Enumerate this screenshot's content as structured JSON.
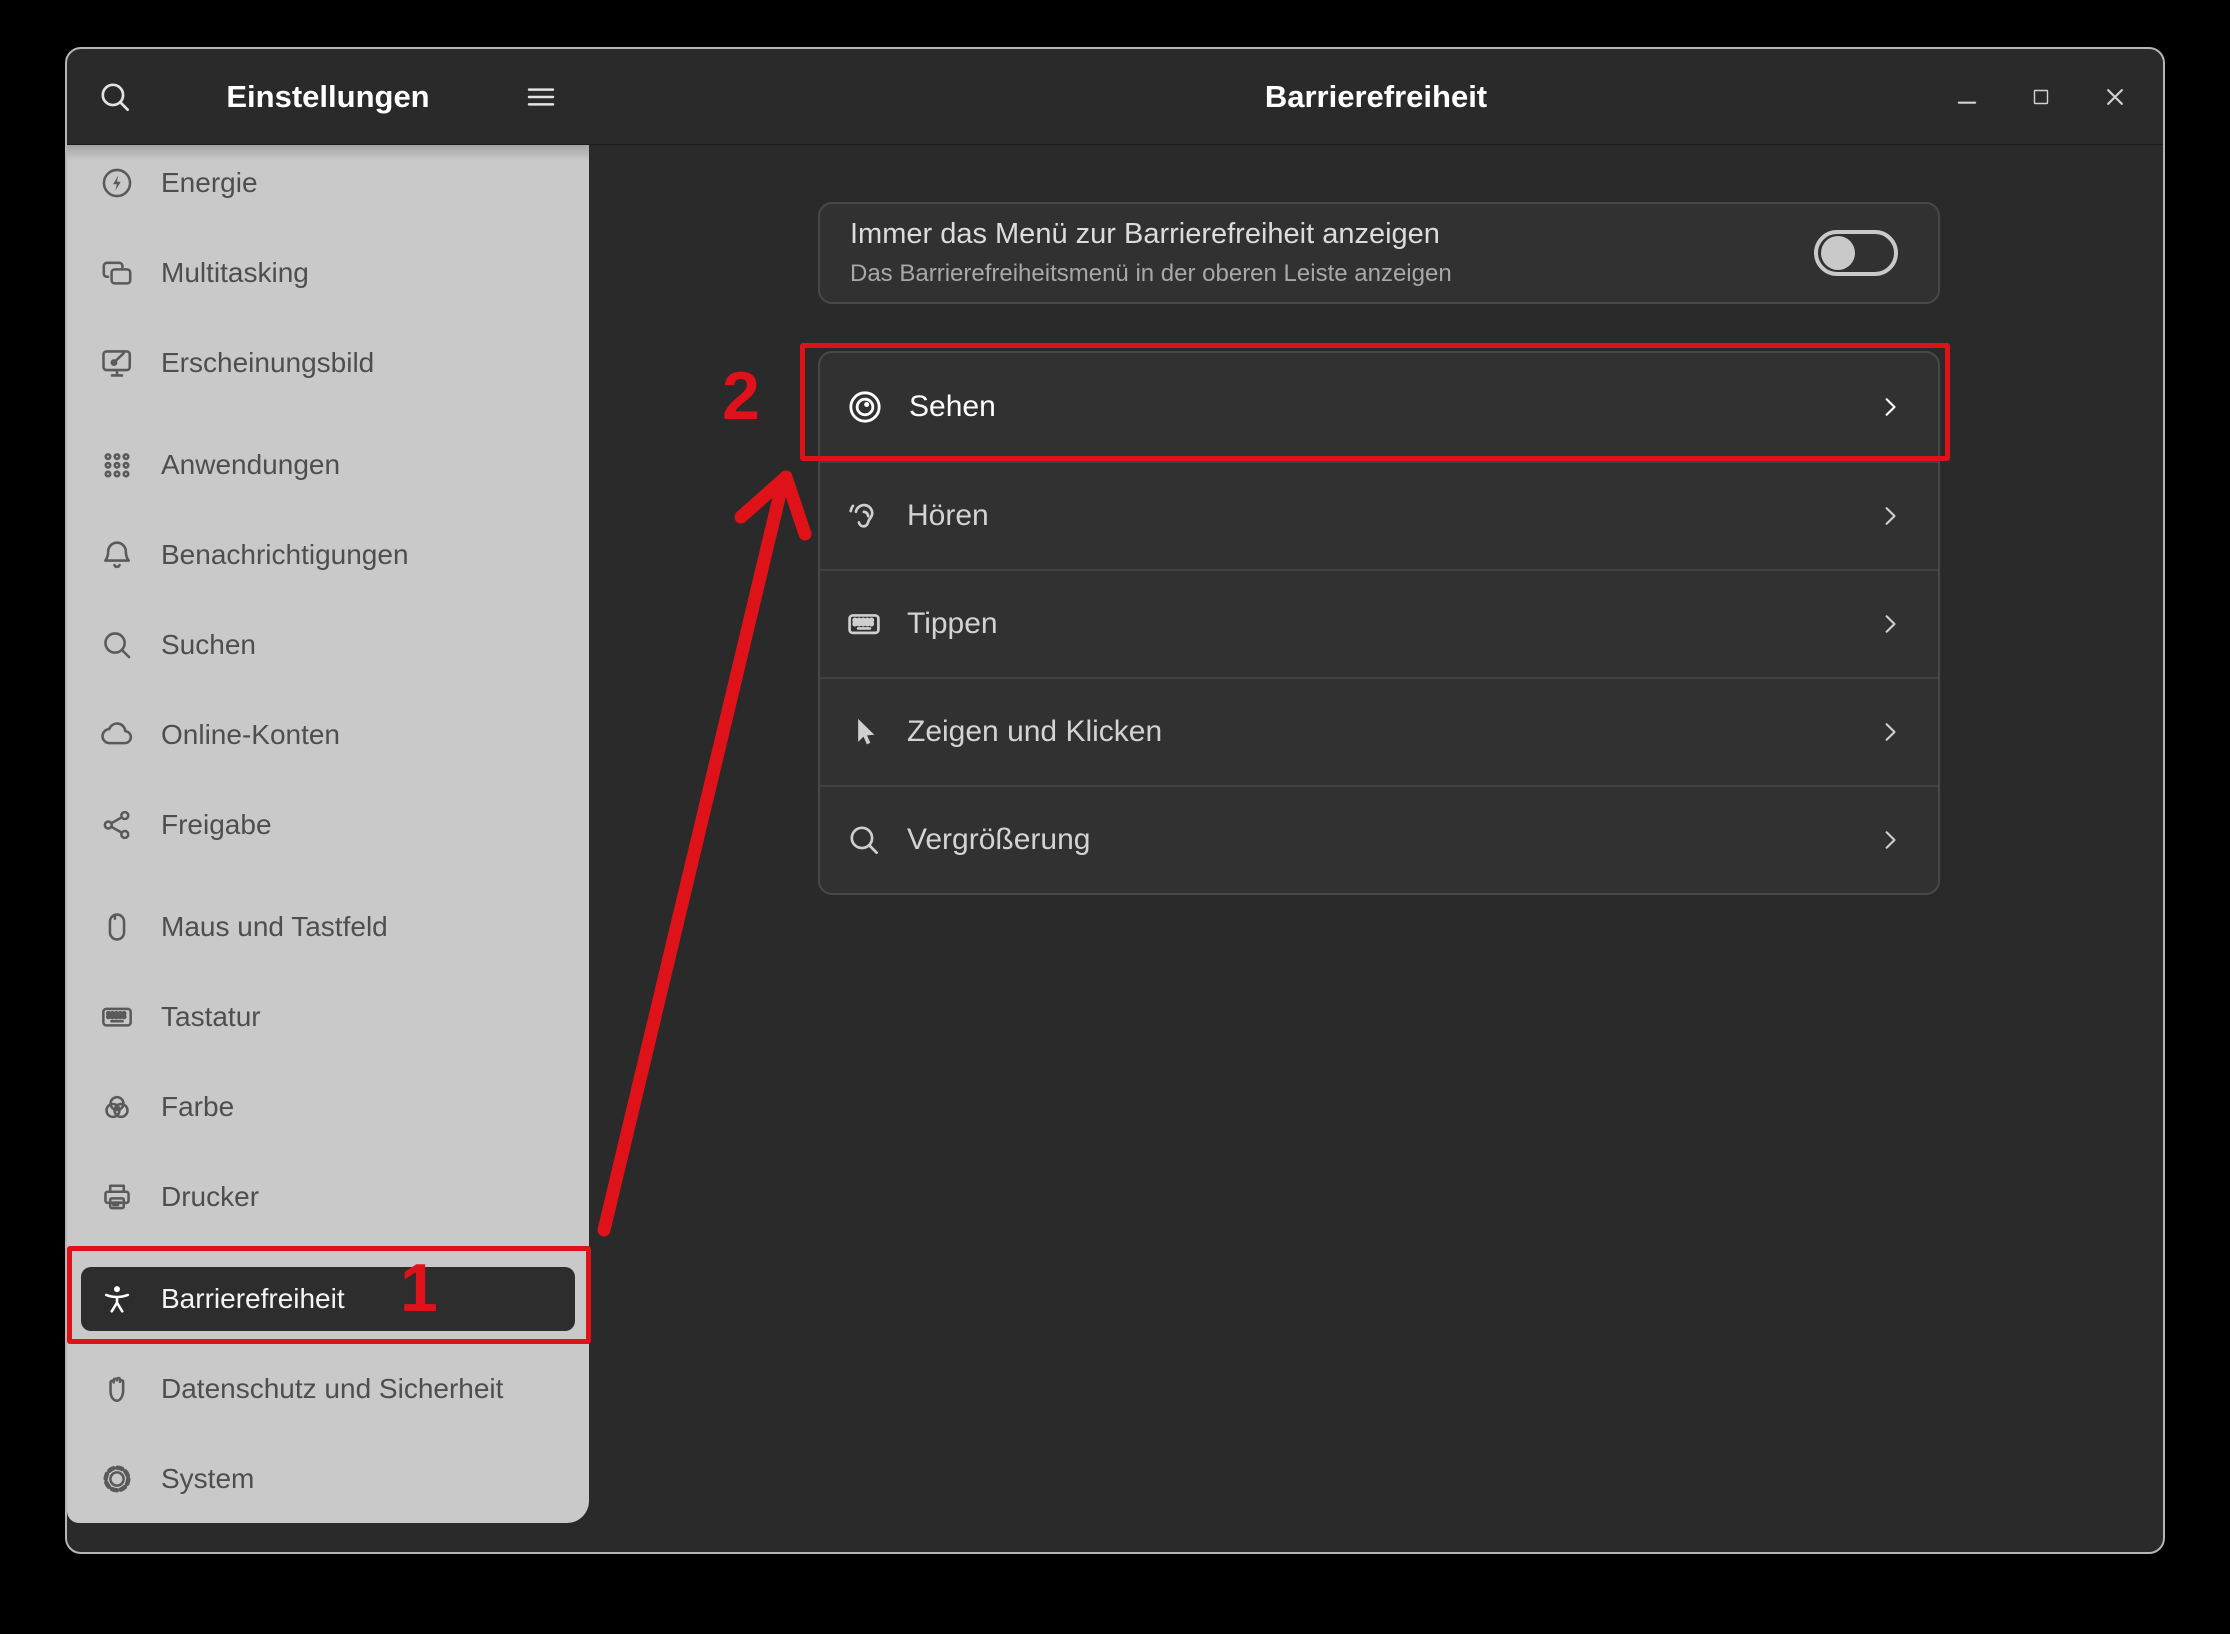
{
  "window": {
    "left_title": "Einstellungen",
    "right_title": "Barrierefreiheit",
    "header_icons": [
      "search",
      "menu"
    ],
    "controls": [
      "minimize",
      "maximize",
      "close"
    ]
  },
  "sidebar": {
    "items": [
      {
        "id": "energie",
        "label": "Energie",
        "icon": "power"
      },
      {
        "id": "multitasking",
        "label": "Multitasking",
        "icon": "multitasking"
      },
      {
        "id": "erscheinungsbild",
        "label": "Erscheinungsbild",
        "icon": "appearance",
        "section_end": true
      },
      {
        "id": "anwendungen",
        "label": "Anwendungen",
        "icon": "apps"
      },
      {
        "id": "benachrichtigungen",
        "label": "Benachrichtigungen",
        "icon": "bell"
      },
      {
        "id": "suchen",
        "label": "Suchen",
        "icon": "search"
      },
      {
        "id": "online-konten",
        "label": "Online-Konten",
        "icon": "cloud"
      },
      {
        "id": "freigabe",
        "label": "Freigabe",
        "icon": "share",
        "section_end": true
      },
      {
        "id": "maus-und-tastfeld",
        "label": "Maus und Tastfeld",
        "icon": "mouse"
      },
      {
        "id": "tastatur",
        "label": "Tastatur",
        "icon": "keyboard"
      },
      {
        "id": "farbe",
        "label": "Farbe",
        "icon": "color"
      },
      {
        "id": "drucker",
        "label": "Drucker",
        "icon": "printer",
        "section_end": true
      },
      {
        "id": "barrierefreiheit",
        "label": "Barrierefreiheit",
        "icon": "accessibility",
        "selected": true
      },
      {
        "id": "datenschutz-und-sicherheit",
        "label": "Datenschutz und Sicherheit",
        "icon": "hand"
      },
      {
        "id": "system",
        "label": "System",
        "icon": "gear"
      }
    ]
  },
  "main": {
    "toggle_row": {
      "title": "Immer das Menü zur Barrierefreiheit anzeigen",
      "subtitle": "Das Barrierefreiheitsmenü in der oberen Leiste anzeigen",
      "state": "off"
    },
    "rows": [
      {
        "id": "sehen",
        "label": "Sehen",
        "icon": "eye",
        "highlighted": true
      },
      {
        "id": "hoeren",
        "label": "Hören",
        "icon": "ear"
      },
      {
        "id": "tippen",
        "label": "Tippen",
        "icon": "keyboard"
      },
      {
        "id": "zeigen-und-klicken",
        "label": "Zeigen und Klicken",
        "icon": "cursor"
      },
      {
        "id": "vergroesserung",
        "label": "Vergrößerung",
        "icon": "magnifier"
      }
    ]
  },
  "annotations": {
    "color": "#e01219",
    "step1": "1",
    "step2": "2"
  }
}
